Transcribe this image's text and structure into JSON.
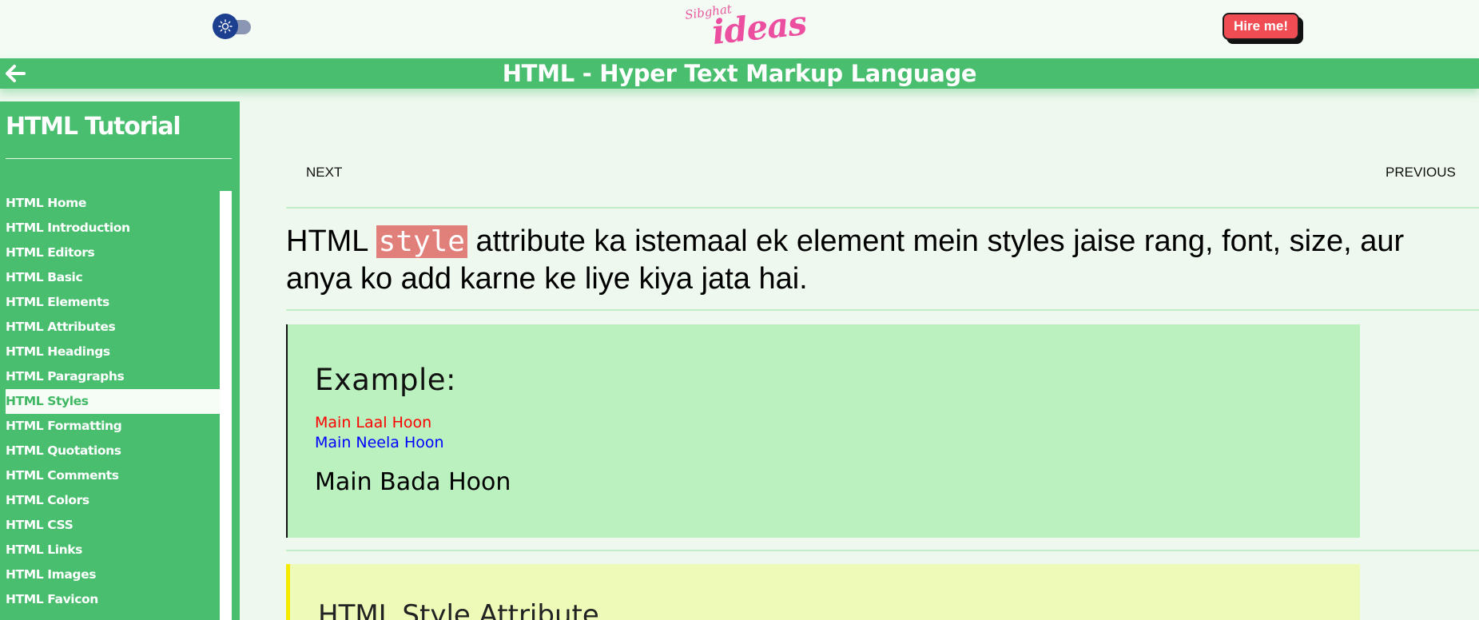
{
  "header": {
    "logo_small": "Sibghat",
    "logo_big": "ideas",
    "hire_label": "Hire me!",
    "theme_toggle_icon": "sun-icon"
  },
  "titlebar": {
    "title": "HTML - Hyper Text Markup Language",
    "back_icon": "arrow-left-icon"
  },
  "sidebar": {
    "heading": "HTML Tutorial",
    "items": [
      {
        "label": "HTML Home"
      },
      {
        "label": "HTML Introduction"
      },
      {
        "label": "HTML Editors"
      },
      {
        "label": "HTML Basic"
      },
      {
        "label": "HTML Elements"
      },
      {
        "label": "HTML Attributes"
      },
      {
        "label": "HTML Headings"
      },
      {
        "label": "HTML Paragraphs"
      },
      {
        "label": "HTML Styles",
        "active": true
      },
      {
        "label": "HTML Formatting"
      },
      {
        "label": "HTML Quotations"
      },
      {
        "label": "HTML Comments"
      },
      {
        "label": "HTML Colors"
      },
      {
        "label": "HTML CSS"
      },
      {
        "label": "HTML Links"
      },
      {
        "label": "HTML Images"
      },
      {
        "label": "HTML Favicon"
      }
    ]
  },
  "main": {
    "next_label": "NEXT",
    "prev_label": "PREVIOUS",
    "intro_before": "HTML ",
    "intro_code": "style",
    "intro_after": " attribute ka istemaal ek element mein styles jaise rang, font, size, aur anya ko add karne ke liye kiya jata hai.",
    "example": {
      "heading": "Example:",
      "line_red": "Main Laal Hoon",
      "line_blue": "Main Neela Hoon",
      "line_big": "Main Bada Hoon"
    },
    "section_heading": "HTML Style Attribute"
  },
  "colors": {
    "accent": "#48be6e",
    "hire": "#ef4d53",
    "code_bg": "#e17f7a",
    "example_bg": "#bbf0bf",
    "note_bg": "#eefab8"
  }
}
